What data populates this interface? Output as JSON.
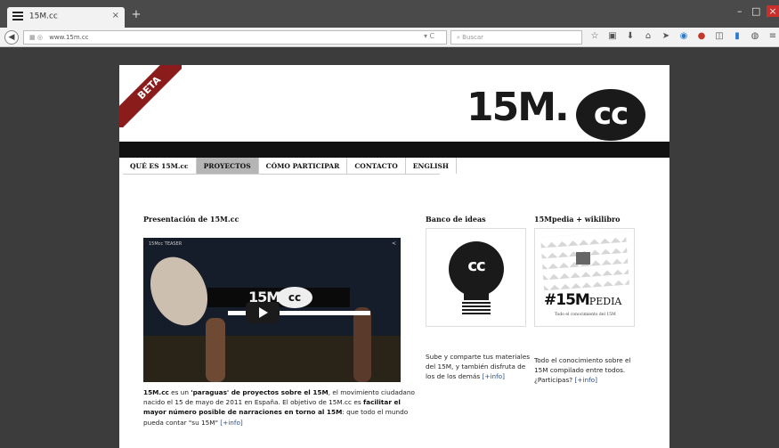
{
  "browser": {
    "tab_title": "15M.cc",
    "tab_close": "×",
    "new_tab": "+",
    "url": "www.15m.cc",
    "search_placeholder": "Buscar",
    "window_minimize": "–",
    "window_maximize": "□",
    "window_close": "×"
  },
  "site": {
    "beta_label": "BETA",
    "logo_text": "15M.",
    "logo_circle": "cc",
    "menu": [
      {
        "label": "QUÉ ES 15M.cc",
        "active": false
      },
      {
        "label": "PROYECTOS",
        "active": true
      },
      {
        "label": "CÓMO PARTICIPAR",
        "active": false
      },
      {
        "label": "CONTACTO",
        "active": false
      },
      {
        "label": "ENGLISH",
        "active": false
      }
    ]
  },
  "main": {
    "section_title": "Presentación de 15M.cc",
    "video": {
      "label": "15Mcc TEASER",
      "logo": "15M.",
      "logo_circle": "cc"
    },
    "desc": {
      "p1_bold": "15M.cc",
      "p1_a": " es un ",
      "p1_bold2": "'paraguas' de proyectos sobre el 15M",
      "p1_b": ", el movimiento ciudadano nacido el 15 de mayo de 2011 en España. El objetivo de 15M.cc es ",
      "p1_bold3": "facilitar el mayor número posible de narraciones en torno al 15M",
      "p1_c": ": que todo el mundo pueda contar \"su 15M\" ",
      "p1_link": "[+info]"
    }
  },
  "sidebar": {
    "bank": {
      "title": "Banco de ideas",
      "icon_text": "cc",
      "text": "Sube y comparte tus materiales del 15M, y también disfruta de los de los demás ",
      "link": "[+info]"
    },
    "wiki": {
      "title": "15Mpedia + wikilibro",
      "pedia_big": "#15M",
      "pedia_small": "PEDIA",
      "pedia_sub": "Todo el conocimiento del 15M",
      "text": "Todo el conocimiento sobre el 15M compilado entre todos. ¿Participas? ",
      "link": "[+info]"
    }
  }
}
